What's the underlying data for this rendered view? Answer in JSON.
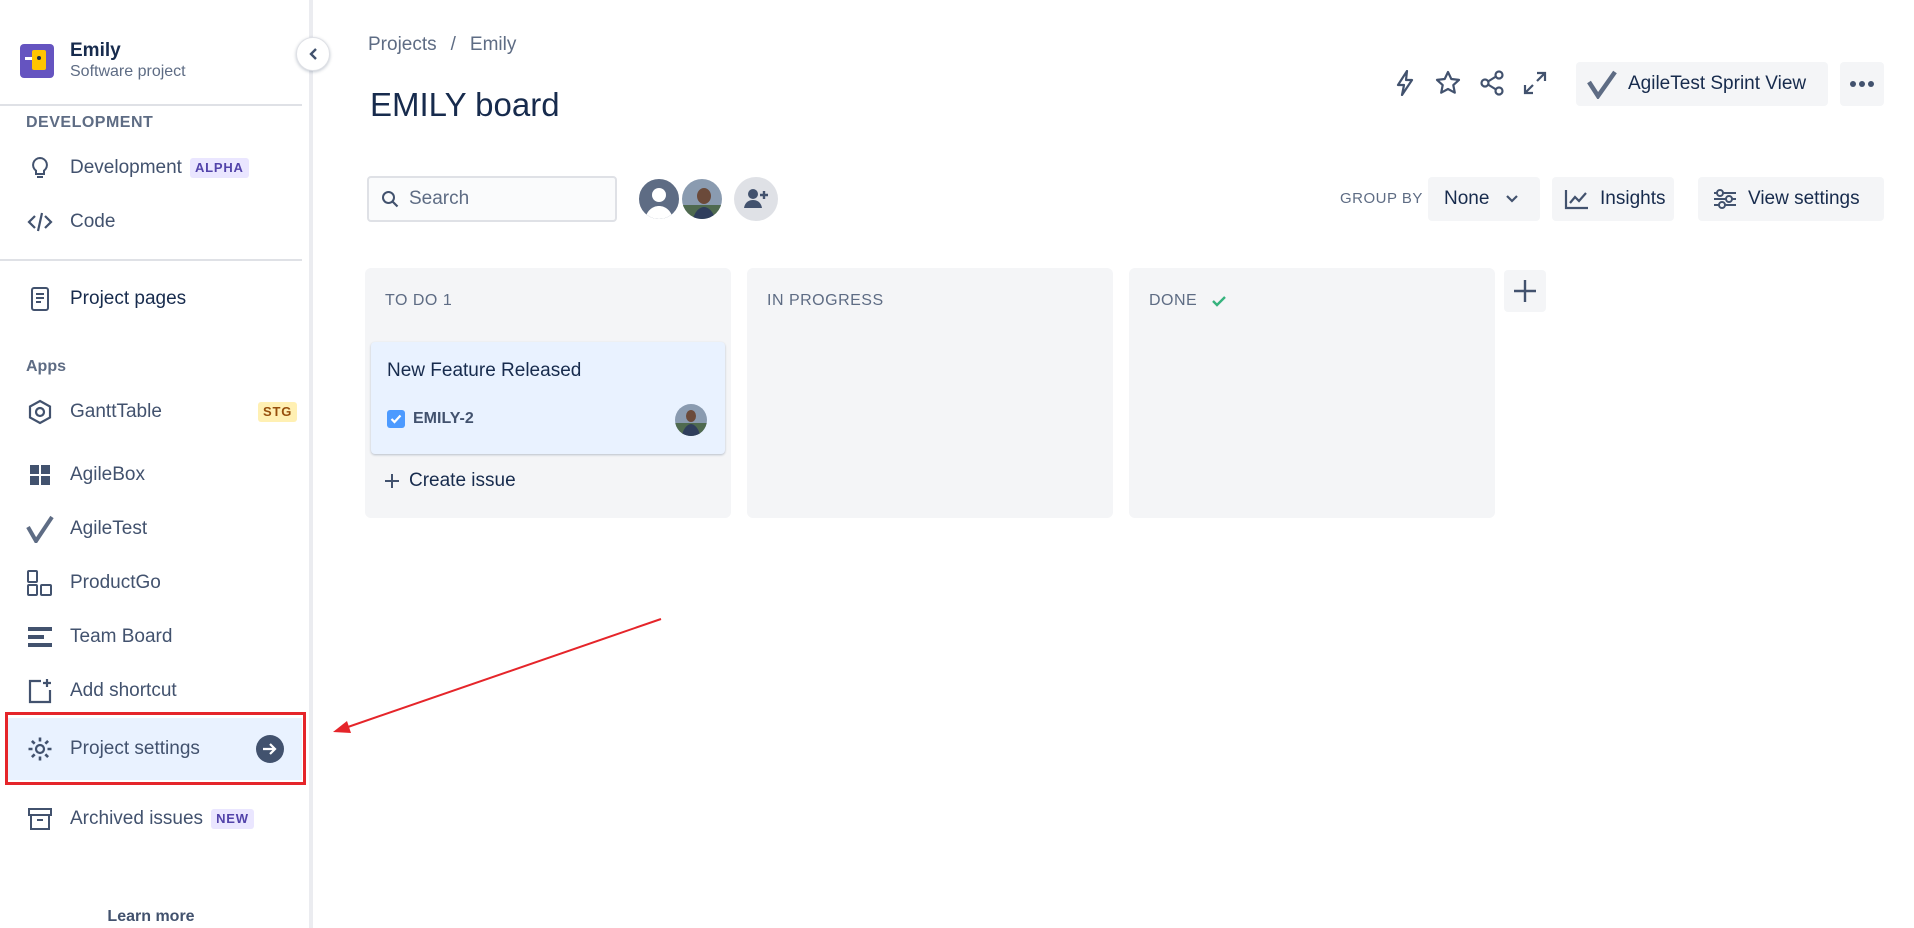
{
  "sidebar": {
    "project_name": "Emily",
    "project_type": "Software project",
    "sections": {
      "development": "DEVELOPMENT",
      "apps": "Apps"
    },
    "items": [
      {
        "label": "Development",
        "badge": "ALPHA",
        "icon": "lightbulb-icon"
      },
      {
        "label": "Code",
        "icon": "code-icon"
      },
      {
        "label": "Project pages",
        "icon": "page-icon"
      },
      {
        "label": "GanttTable",
        "badge": "STG",
        "icon": "gantt-icon"
      },
      {
        "label": "AgileBox",
        "icon": "grid-icon"
      },
      {
        "label": "AgileTest",
        "icon": "agiletest-check-icon"
      },
      {
        "label": "ProductGo",
        "icon": "productgo-icon"
      },
      {
        "label": "Team Board",
        "icon": "team-board-icon"
      },
      {
        "label": "Add shortcut",
        "icon": "add-shortcut-icon"
      },
      {
        "label": "Project settings",
        "icon": "gear-icon"
      },
      {
        "label": "Archived issues",
        "badge": "NEW",
        "icon": "archive-icon"
      }
    ],
    "learn_more": "Learn more"
  },
  "header": {
    "breadcrumb": [
      "Projects",
      "/",
      "Emily"
    ],
    "title": "EMILY board",
    "agiletest_button": "AgileTest Sprint View"
  },
  "toolbar": {
    "search_placeholder": "Search",
    "group_by_label": "GROUP BY",
    "group_by_value": "None",
    "insights_label": "Insights",
    "view_settings_label": "View settings"
  },
  "board": {
    "columns": [
      {
        "title": "TO DO 1"
      },
      {
        "title": "IN PROGRESS"
      },
      {
        "title": "DONE"
      }
    ],
    "card": {
      "title": "New Feature Released",
      "key": "EMILY-2"
    },
    "create_issue_label": "Create issue"
  },
  "colors": {
    "annotation_red": "#e5252a",
    "active_item_bg": "#e9f2ff",
    "text_primary": "#172b4d",
    "done_check": "#36b37e"
  }
}
